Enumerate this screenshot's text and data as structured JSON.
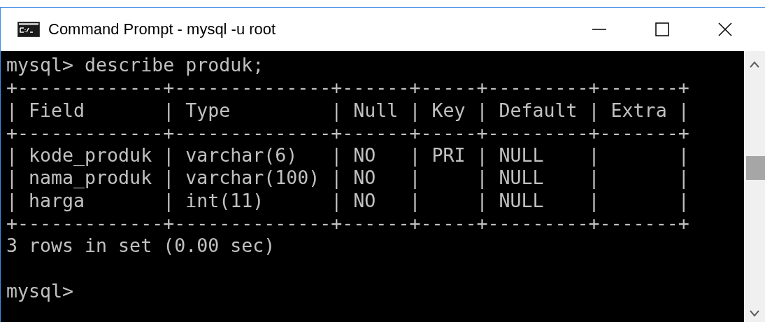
{
  "window": {
    "title": "Command Prompt - mysql  -u root"
  },
  "console": {
    "lines": [
      "mysql> describe produk;",
      "+-------------+--------------+------+-----+---------+-------+",
      "| Field       | Type         | Null | Key | Default | Extra |",
      "+-------------+--------------+------+-----+---------+-------+",
      "| kode_produk | varchar(6)   | NO   | PRI | NULL    |       |",
      "| nama_produk | varchar(100) | NO   |     | NULL    |       |",
      "| harga       | int(11)      | NO   |     | NULL    |       |",
      "+-------------+--------------+------+-----+---------+-------+",
      "3 rows in set (0.00 sec)"
    ],
    "prompt": "mysql>"
  }
}
